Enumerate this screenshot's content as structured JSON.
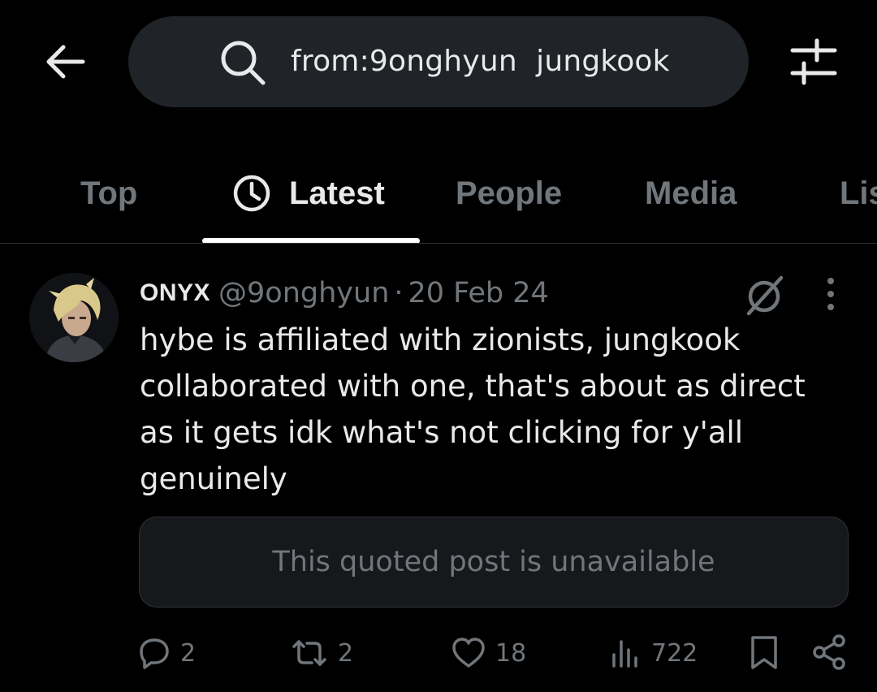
{
  "header": {
    "back_icon": "arrow-left-icon",
    "search_icon": "search-icon",
    "search_query": "from:9onghyun  jungkook",
    "filter_icon": "sliders-icon"
  },
  "tabs": [
    {
      "label": "Top",
      "active": false
    },
    {
      "label": "Latest",
      "active": true,
      "icon": "clock-icon"
    },
    {
      "label": "People",
      "active": false
    },
    {
      "label": "Media",
      "active": false
    },
    {
      "label": "Lists",
      "active": false
    }
  ],
  "post": {
    "author_name": "ONYX",
    "author_handle": "@9onghyun",
    "separator": "·",
    "date": "20 Feb 24",
    "text": "hybe is affiliated with zionists, jungkook collaborated with one, that's about as direct as it gets idk what's not clicking for y'all genuinely",
    "quoted_post": "This quoted post is unavailable",
    "actions": {
      "replies": "2",
      "reposts": "2",
      "likes": "18",
      "views": "722"
    }
  },
  "colors": {
    "background": "#000000",
    "primary_text": "#e7e9ea",
    "secondary_text": "#71767b",
    "search_bg": "#202327",
    "quote_bg": "#16181c"
  }
}
